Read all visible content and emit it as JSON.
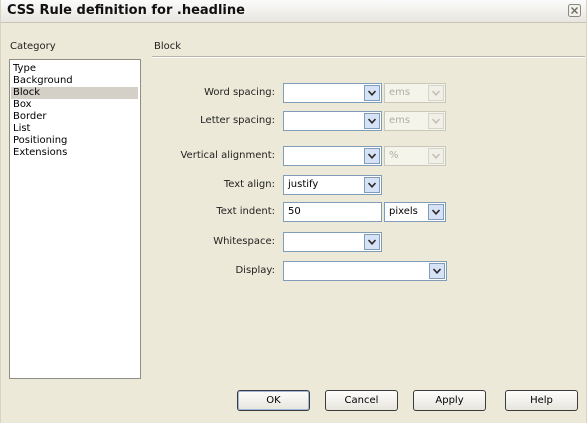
{
  "window": {
    "title": "CSS Rule definition for .headline"
  },
  "category": {
    "heading": "Category",
    "items": [
      "Type",
      "Background",
      "Block",
      "Box",
      "Border",
      "List",
      "Positioning",
      "Extensions"
    ],
    "selected": "Block"
  },
  "panel": {
    "heading": "Block"
  },
  "fields": {
    "word_spacing": {
      "label": "Word spacing:",
      "value": "",
      "unit": "ems"
    },
    "letter_spacing": {
      "label": "Letter spacing:",
      "value": "",
      "unit": "ems"
    },
    "vertical_alignment": {
      "label": "Vertical alignment:",
      "value": "",
      "unit": "%"
    },
    "text_align": {
      "label": "Text align:",
      "value": "justify"
    },
    "text_indent": {
      "label": "Text indent:",
      "value": "50",
      "unit": "pixels"
    },
    "whitespace": {
      "label": "Whitespace:",
      "value": ""
    },
    "display": {
      "label": "Display:",
      "value": ""
    }
  },
  "buttons": {
    "ok": "OK",
    "cancel": "Cancel",
    "apply": "Apply",
    "help": "Help"
  }
}
